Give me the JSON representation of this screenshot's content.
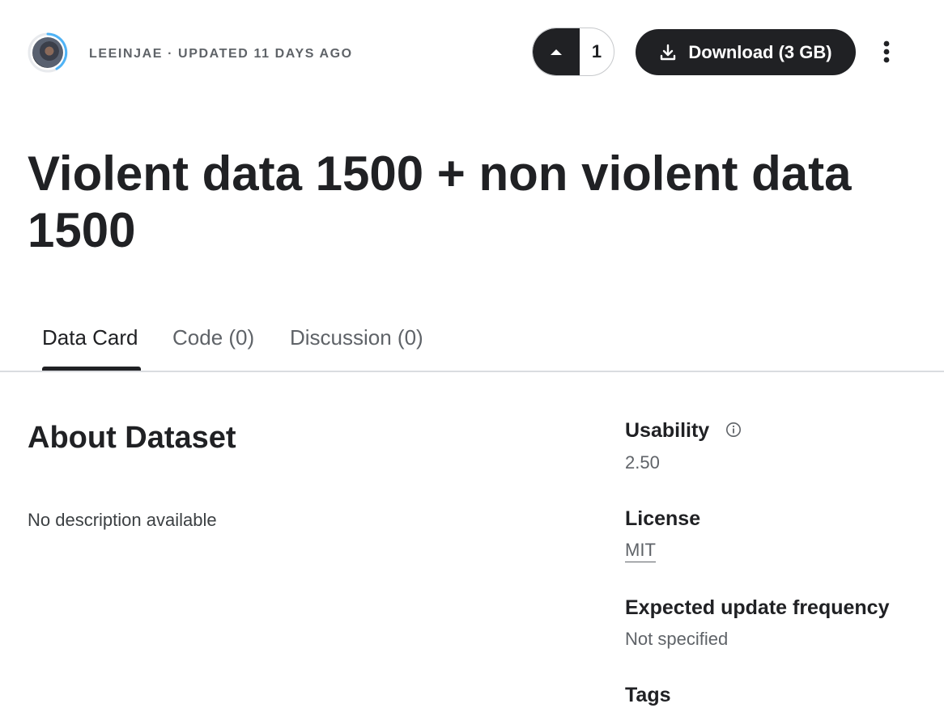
{
  "header": {
    "owner_line": "LEEINJAE · UPDATED 11 DAYS AGO",
    "upvote_count": "1",
    "download_label": "Download (3 GB)",
    "icons": {
      "upvote": "caret-up-icon",
      "download": "download-icon",
      "more": "more-vert-icon"
    }
  },
  "title": "Violent data 1500 + non violent data 1500",
  "tabs": [
    {
      "label": "Data Card",
      "active": true
    },
    {
      "label": "Code (0)",
      "active": false
    },
    {
      "label": "Discussion (0)",
      "active": false
    }
  ],
  "about": {
    "heading": "About Dataset",
    "description": "No description available"
  },
  "sidebar": {
    "usability": {
      "label": "Usability",
      "value": "2.50"
    },
    "license": {
      "label": "License",
      "value": "MIT"
    },
    "update_frequency": {
      "label": "Expected update frequency",
      "value": "Not specified"
    },
    "tags": {
      "label": "Tags"
    }
  },
  "colors": {
    "primary": "#202124",
    "secondary_text": "#5f6368",
    "avatar_ring": "#4fb3f6",
    "divider": "#dadce0"
  }
}
